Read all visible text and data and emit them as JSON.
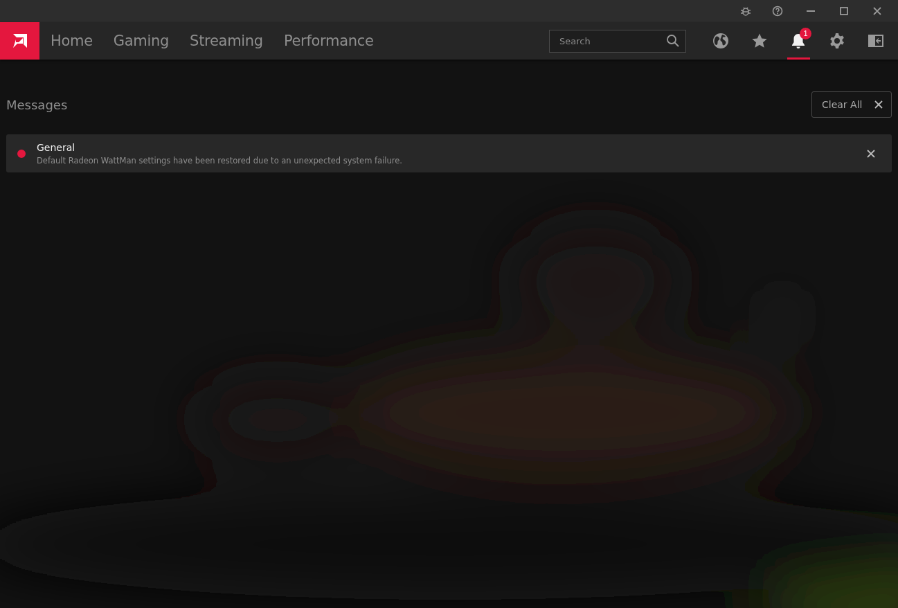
{
  "title_bar": {
    "buttons": [
      {
        "kind": "bug"
      },
      {
        "kind": "help"
      },
      {
        "kind": "minimize"
      },
      {
        "kind": "maximize"
      },
      {
        "kind": "close"
      }
    ]
  },
  "nav": {
    "tabs": [
      {
        "label": "Home",
        "selected": false
      },
      {
        "label": "Gaming",
        "selected": false
      },
      {
        "label": "Streaming",
        "selected": false
      },
      {
        "label": "Performance",
        "selected": false
      }
    ],
    "search": {
      "placeholder": "Search"
    },
    "tools": [
      {
        "kind": "globe",
        "selected": false
      },
      {
        "kind": "star",
        "selected": false
      },
      {
        "kind": "bell",
        "selected": true,
        "badge": "1"
      },
      {
        "kind": "gear",
        "selected": false
      },
      {
        "kind": "panel",
        "selected": false
      }
    ]
  },
  "messages": {
    "title": "Messages",
    "clear_button": "Clear All",
    "items": [
      {
        "category": "General",
        "text": "Default Radeon WattMan settings have been restored due to an unexpected system failure.",
        "color": "#e4173e"
      }
    ]
  }
}
